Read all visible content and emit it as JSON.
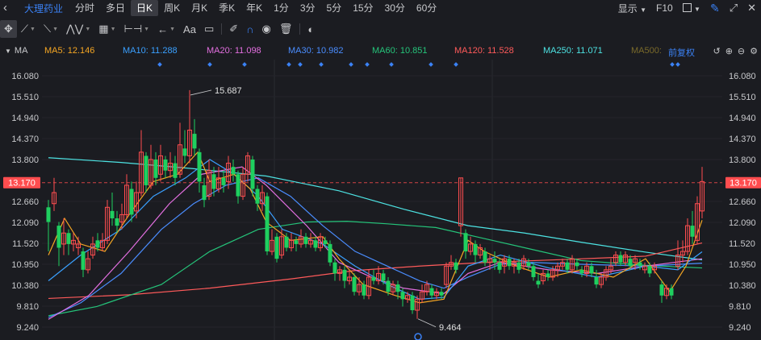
{
  "stock_name": "大理药业",
  "periods": [
    "分时",
    "多日",
    "日K",
    "周K",
    "月K",
    "季K",
    "年K",
    "1分",
    "3分",
    "5分",
    "15分",
    "30分",
    "60分"
  ],
  "active_period": "日K",
  "top_right": {
    "display_label": "显示",
    "f10_label": "F10"
  },
  "toolbar": {
    "text_tool_label": "Aa"
  },
  "ma_bar": {
    "label": "MA",
    "items": [
      {
        "name": "MA5",
        "text": "MA5: 12.146",
        "color": "#f5a623"
      },
      {
        "name": "MA10",
        "text": "MA10: 11.288",
        "color": "#3aa0ff"
      },
      {
        "name": "MA20",
        "text": "MA20: 11.098",
        "color": "#e36fe0"
      },
      {
        "name": "MA30",
        "text": "MA30: 10.982",
        "color": "#4a8dff"
      },
      {
        "name": "MA60",
        "text": "MA60: 10.851",
        "color": "#25c47a"
      },
      {
        "name": "MA120",
        "text": "MA120: 11.528",
        "color": "#ff5a5a"
      },
      {
        "name": "MA250",
        "text": "MA250: 11.071",
        "color": "#4de3e3"
      },
      {
        "name": "MA500",
        "text": "MA500:",
        "color": "#7a6a2a"
      }
    ],
    "adjust_label": "前复权"
  },
  "chart_data": {
    "type": "candlestick",
    "y_ticks": [
      "16.080",
      "15.510",
      "14.940",
      "14.370",
      "13.800",
      "13.170",
      "12.660",
      "12.090",
      "11.520",
      "10.950",
      "10.380",
      "9.810",
      "9.240"
    ],
    "ylim": [
      9.24,
      16.08
    ],
    "current_price": "13.170",
    "high_annotation": "15.687",
    "low_annotation": "9.464",
    "up_color": "#ff4d4f",
    "down_color": "#1fcf5f"
  }
}
